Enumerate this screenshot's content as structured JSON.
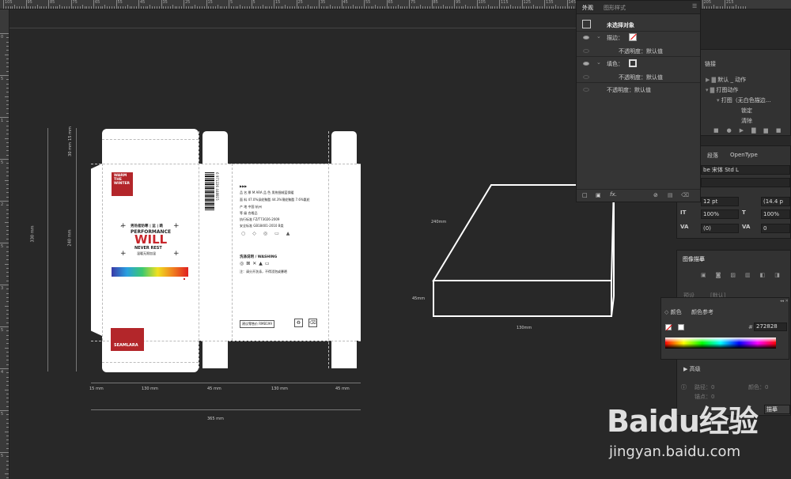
{
  "ruler": {
    "top_numbers": [
      "105",
      "95",
      "85",
      "75",
      "65",
      "55",
      "45",
      "35",
      "25",
      "15",
      "5",
      "5",
      "15",
      "25",
      "35",
      "45",
      "55",
      "65",
      "75",
      "85",
      "95",
      "105",
      "115",
      "125",
      "135",
      "145",
      "155",
      "165",
      "175",
      "185",
      "195",
      "205",
      "215"
    ],
    "left_numbers": [
      "0",
      "5",
      "1",
      "5",
      "2",
      "5",
      "3",
      "5",
      "4",
      "5",
      "5"
    ]
  },
  "dieline": {
    "brand_box_text": [
      "WARM",
      "THE",
      "WINTER"
    ],
    "title_cn": "男热者防寒 | 运 | 跳",
    "performance": "PERFORMANCE",
    "will": "WILL",
    "never_rest": "NEVER REST",
    "subtitle_cn": "温暖无限加温",
    "brand_bottom": "SEAMLARA",
    "barcode_number": "6 971226 448815",
    "info_rows": [
      "品 名 厚 M ARA 品 色 男热细绒蓝保暖",
      "面 料 47.0%涤纶聚酯 44.3%锦纶聚酯 7.6%氨纶",
      "产 地 中国 杭州",
      "等 级 合格品",
      "执行标准 FZ/T73026-2009",
      "安全标准 GB18401-2010 B类"
    ],
    "washing_title": "洗涤说明 / WASHING",
    "washing_note": "注：请分开洗涤，不得浸泡或暴晒",
    "price_label": "建议零售价 RMB199",
    "dims": {
      "left_330": "330 mm",
      "left_240": "240 mm",
      "left_30": "30 mm",
      "left_15": "15 mm",
      "bottom": [
        "15 mm",
        "130 mm",
        "45 mm",
        "130 mm",
        "45 mm"
      ],
      "total": "365 mm"
    }
  },
  "box3d": {
    "label_240": "240mm",
    "label_45": "45mm",
    "label_130": "130mm"
  },
  "appearance_panel": {
    "tabs": [
      "外观",
      "图形样式"
    ],
    "no_selection": "未选择对象",
    "stroke_label": "描边：",
    "opacity_default_1": "不透明度：默认值",
    "fill_label": "填色：",
    "opacity_default_2": "不透明度：默认值",
    "opacity_default_3": "不透明度：默认值",
    "fx_label": "fx."
  },
  "actions_panel": {
    "tab": "链接",
    "items": [
      "默认 _ 动作",
      "打图动作",
      "打图（无白色描边...",
      "锁定",
      "清除"
    ]
  },
  "char_panel": {
    "tabs": [
      "段落",
      "OpenType"
    ],
    "font": "be 宋体 Std L",
    "size": "12 pt",
    "leading": "(14.4 p",
    "scale_v": "100%",
    "scale_h": "100%",
    "kerning": "(0)",
    "tracking": "0"
  },
  "image_trace": {
    "tab": "图像描摹",
    "preset_label": "预设",
    "preset_value": "[默认]"
  },
  "color_panel": {
    "tabs": [
      "颜色",
      "颜色参考"
    ],
    "hex_label": "#",
    "hex_value": "272828",
    "advanced": "高级",
    "path_label": "路径：0",
    "anchor_label": "锚点：0",
    "color_count": "颜色：0",
    "trace_btn": "描摹"
  },
  "watermark": {
    "logo": "Baidu经验",
    "url": "jingyan.baidu.com"
  }
}
